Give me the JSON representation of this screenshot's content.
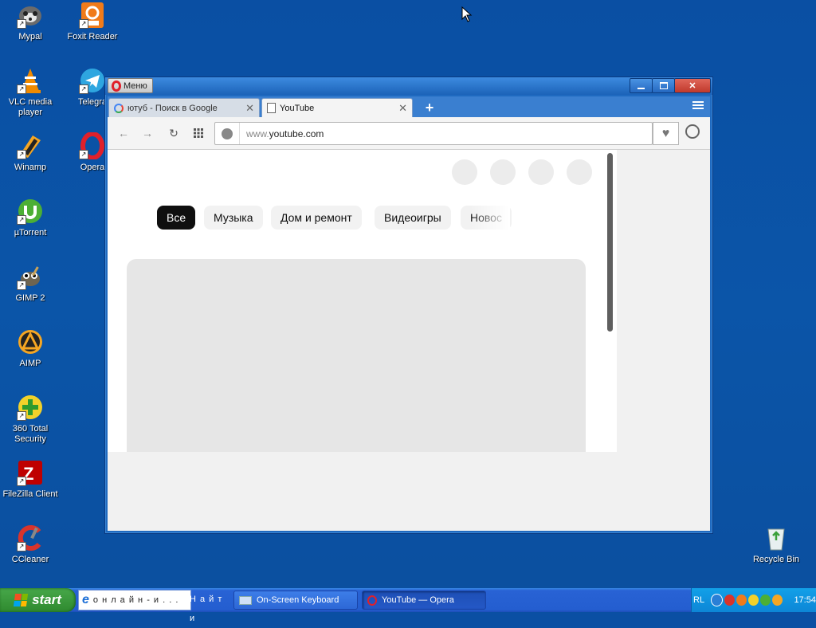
{
  "desktop": {
    "icons": [
      {
        "label": "Mypal"
      },
      {
        "label": "Foxit Reader"
      },
      {
        "label": "VLC media player"
      },
      {
        "label": "Telegra"
      },
      {
        "label": "Winamp"
      },
      {
        "label": "Opera"
      },
      {
        "label": "µTorrent"
      },
      {
        "label": "GIMP 2"
      },
      {
        "label": "AIMP"
      },
      {
        "label": "360 Total Security"
      },
      {
        "label": "FileZilla Client"
      },
      {
        "label": "CCleaner"
      },
      {
        "label": "Recycle Bin"
      }
    ]
  },
  "browser": {
    "menu_label": "Меню",
    "tabs": [
      {
        "title": "ютуб - Поиск в Google",
        "icon": "google-icon",
        "active": false
      },
      {
        "title": "YouTube",
        "icon": "page-icon",
        "active": true
      }
    ],
    "address": {
      "prefix": "www.",
      "host": "youtube.com"
    },
    "page": {
      "chips": [
        {
          "label": "Все",
          "selected": true
        },
        {
          "label": "Музыка",
          "selected": false
        },
        {
          "label": "Дом и ремонт",
          "selected": false
        },
        {
          "label": "Видеоигры",
          "selected": false
        },
        {
          "label": "Новос",
          "selected": false
        }
      ]
    }
  },
  "taskbar": {
    "start_label": "start",
    "quicklaunch_text_1": "о н л а й н - и . . .",
    "quicklaunch_text_2": "Н а й т и",
    "tasks": [
      {
        "label": "On-Screen Keyboard",
        "active": false
      },
      {
        "label": "YouTube — Opera",
        "active": true
      }
    ],
    "tray": {
      "lang": "RL",
      "time": "17:54"
    }
  },
  "colors": {
    "desktop": "#0b4f9f",
    "opera_red": "#e0202a",
    "taskbar": "#245ed0",
    "chip_selected": "#0f0f0f"
  }
}
